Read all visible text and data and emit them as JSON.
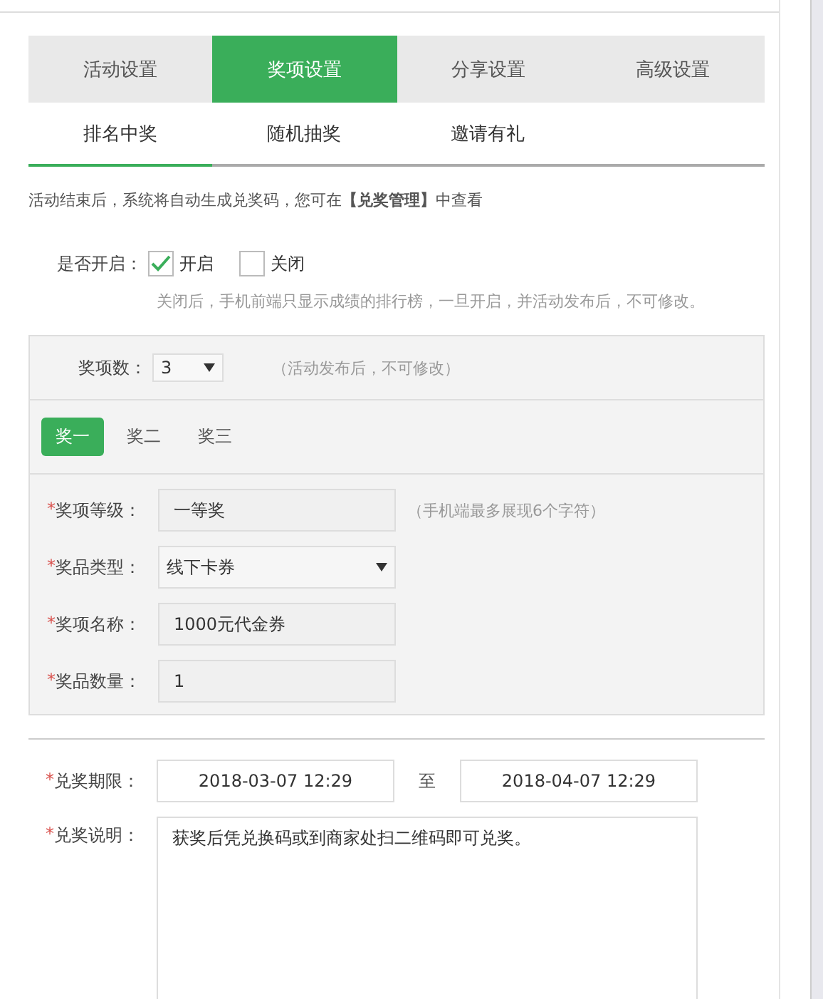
{
  "tabs": [
    {
      "label": "活动设置",
      "selected": false
    },
    {
      "label": "奖项设置",
      "selected": true
    },
    {
      "label": "分享设置",
      "selected": false
    },
    {
      "label": "高级设置",
      "selected": false
    }
  ],
  "subtabs": [
    {
      "label": "排名中奖",
      "selected": true
    },
    {
      "label": "随机抽奖",
      "selected": false
    },
    {
      "label": "邀请有礼",
      "selected": false
    }
  ],
  "notice": "活动结束后，系统将自动生成兑奖码，您可在**【兑奖管理】**中查看",
  "enable": {
    "label": "是否开启：",
    "options": [
      {
        "label": "开启",
        "checked": true
      },
      {
        "label": "关闭",
        "checked": false
      }
    ],
    "hint": "关闭后，手机前端只显示成绩的排行榜，一旦开启，并活动发布后，不可修改。"
  },
  "prize_count": {
    "label": "奖项数：",
    "value": "3",
    "hint": "（活动发布后，不可修改）"
  },
  "prize_tabs": [
    {
      "label": "奖一",
      "selected": true
    },
    {
      "label": "奖二",
      "selected": false
    },
    {
      "label": "奖三",
      "selected": false
    }
  ],
  "prize_fields": [
    {
      "mark": "*",
      "label": "奖项等级：",
      "kind": "input",
      "value": "一等奖",
      "hint": "（手机端最多展现6个字符）"
    },
    {
      "mark": "*",
      "label": "奖品类型：",
      "kind": "select",
      "value": "线下卡券"
    },
    {
      "mark": "*",
      "label": "奖项名称：",
      "kind": "input",
      "value": "1000元代金券"
    },
    {
      "mark": "*",
      "label": "奖品数量：",
      "kind": "input",
      "value": "1"
    }
  ],
  "redeem_period": {
    "mark": "*",
    "label": "兑奖期限：",
    "start": "2018-03-07 12:29",
    "separator": "至",
    "end": "2018-04-07 12:29"
  },
  "redeem_note": {
    "mark": "*",
    "label": "兑奖说明：",
    "value": "获奖后凭兑换码或到商家处扫二维码即可兑奖。"
  }
}
